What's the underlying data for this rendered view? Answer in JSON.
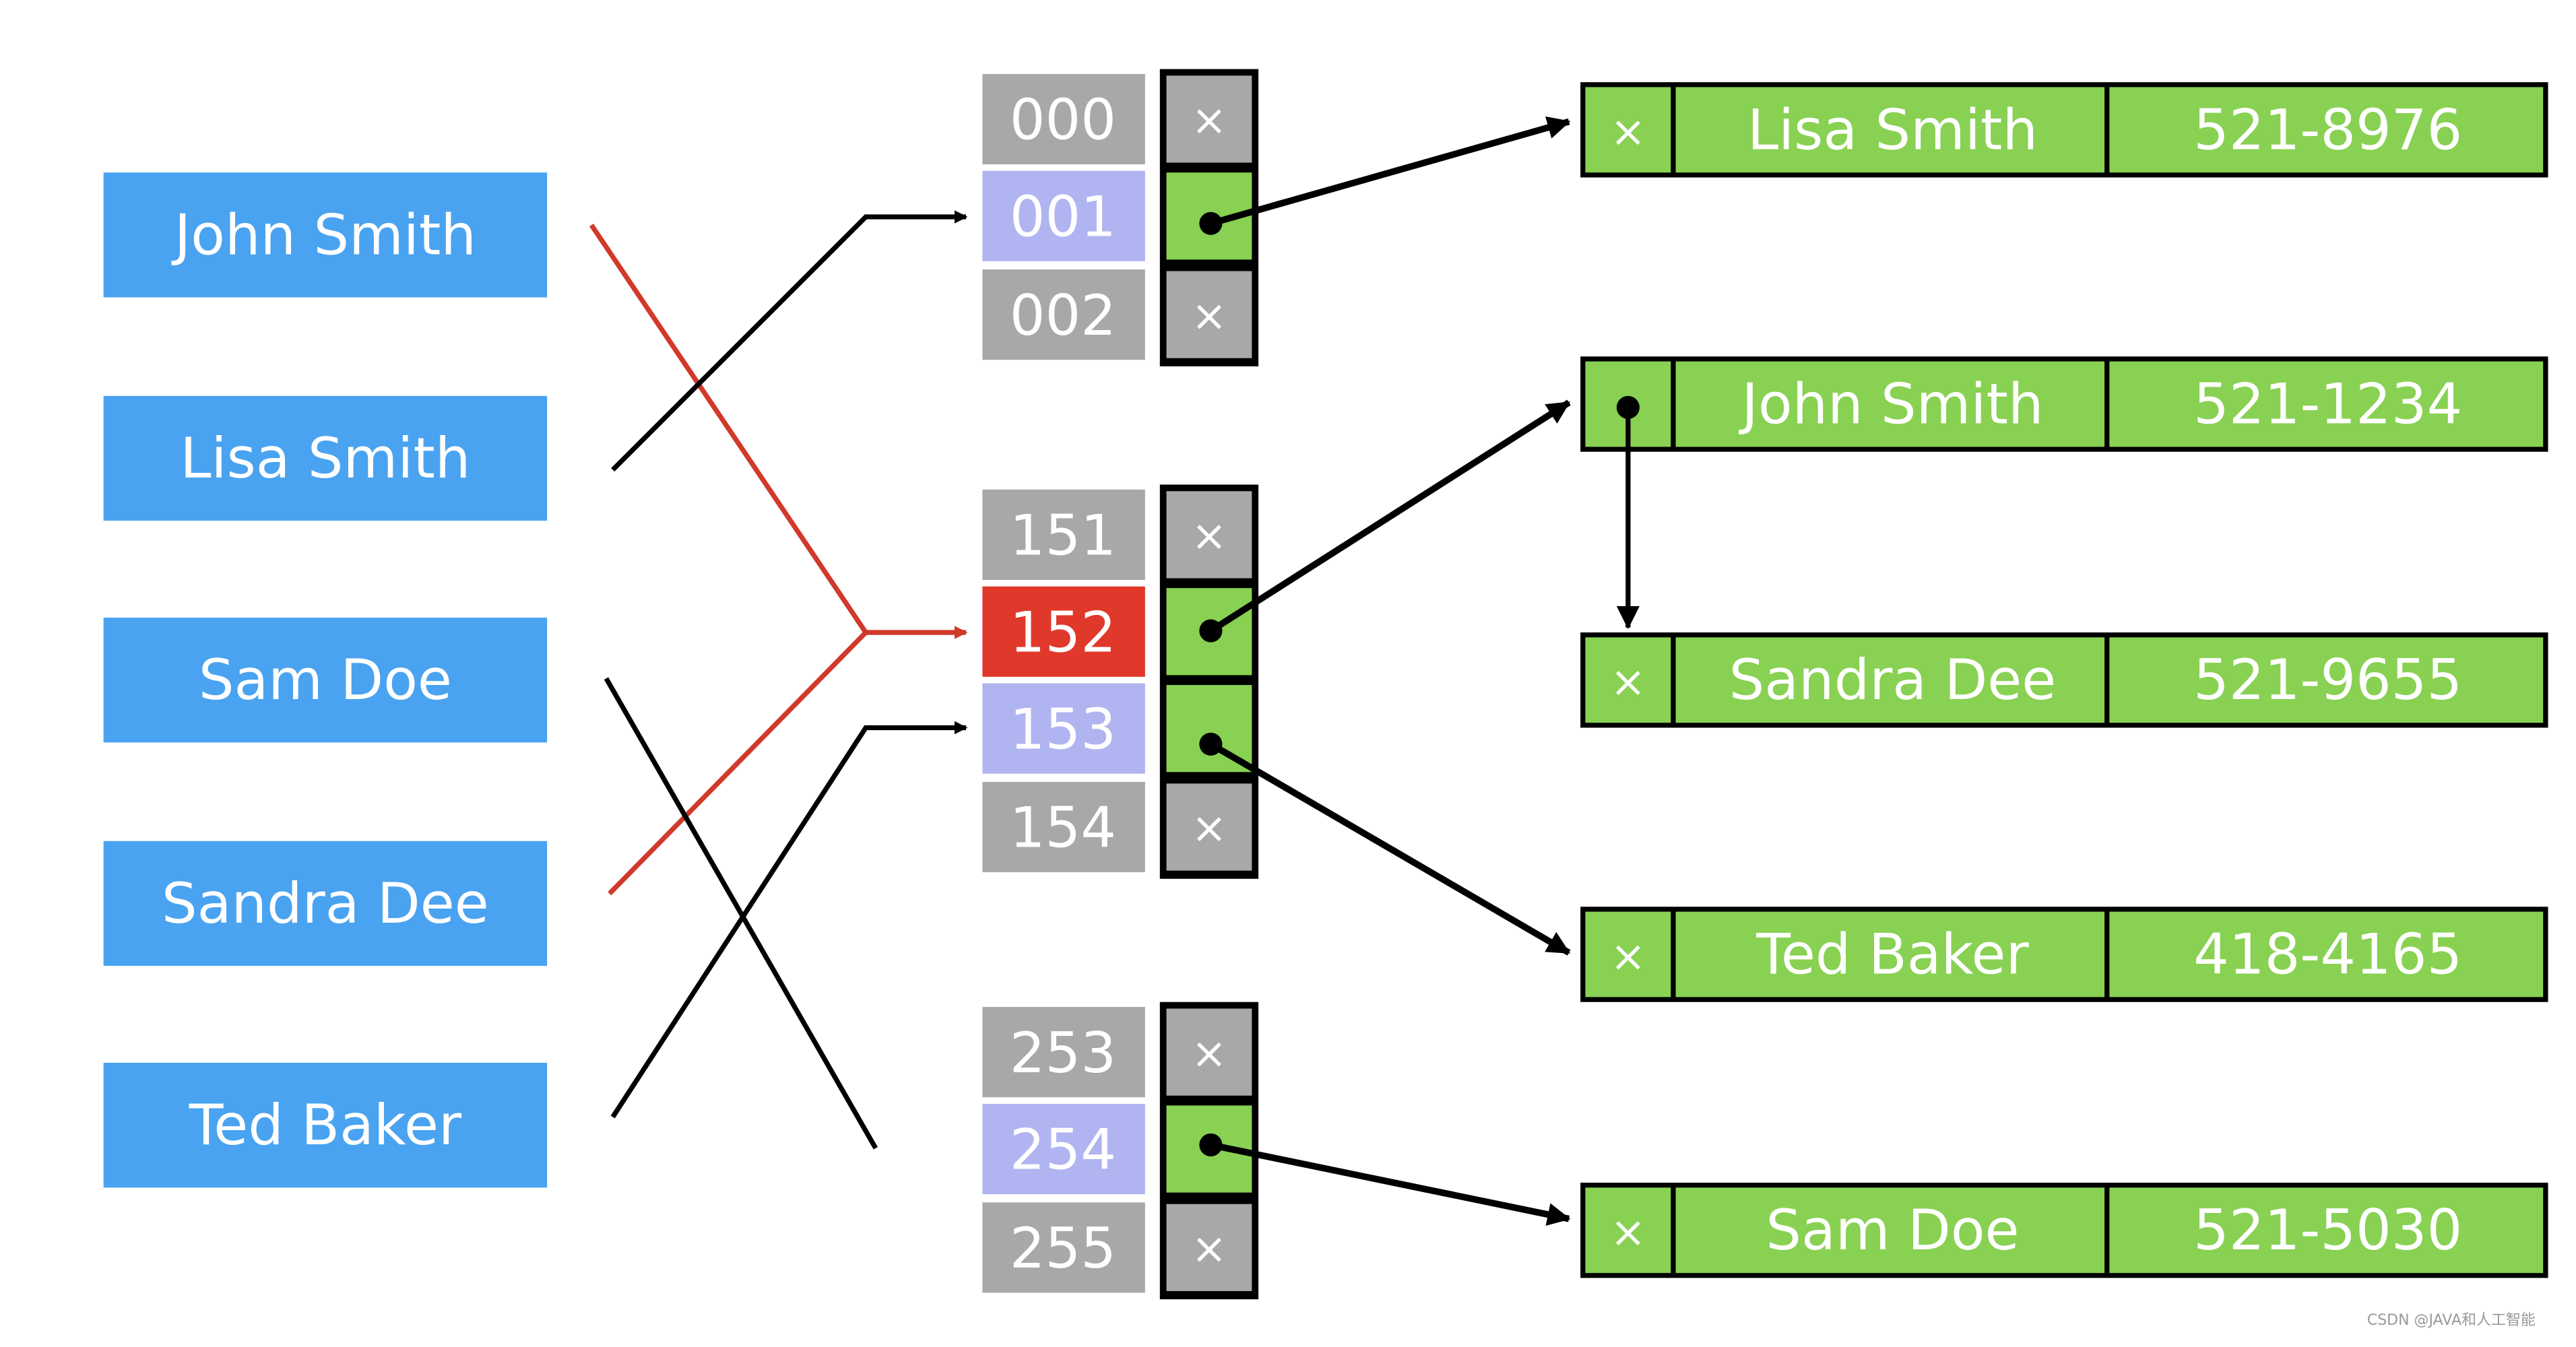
{
  "colors": {
    "key_box": "#4aa3f0",
    "bucket_empty": "#a8a8a8",
    "bucket_used": "#b0b4f0",
    "bucket_collision": "#e0382a",
    "entry": "#88d152",
    "collision_line": "#d0392b",
    "line": "#000000"
  },
  "keys": [
    "John Smith",
    "Lisa Smith",
    "Sam Doe",
    "Sandra Dee",
    "Ted Baker"
  ],
  "buckets": [
    {
      "index": "000",
      "state": "empty",
      "pointer": "×"
    },
    {
      "index": "001",
      "state": "used",
      "pointer": ""
    },
    {
      "index": "002",
      "state": "empty",
      "pointer": "×"
    },
    {
      "index": "151",
      "state": "empty",
      "pointer": "×"
    },
    {
      "index": "152",
      "state": "collision",
      "pointer": ""
    },
    {
      "index": "153",
      "state": "used",
      "pointer": ""
    },
    {
      "index": "154",
      "state": "empty",
      "pointer": "×"
    },
    {
      "index": "253",
      "state": "empty",
      "pointer": "×"
    },
    {
      "index": "254",
      "state": "used",
      "pointer": ""
    },
    {
      "index": "255",
      "state": "empty",
      "pointer": "×"
    }
  ],
  "entries": [
    {
      "next": "×",
      "name": "Lisa Smith",
      "phone": "521-8976"
    },
    {
      "next": "",
      "name": "John Smith",
      "phone": "521-1234"
    },
    {
      "next": "×",
      "name": "Sandra Dee",
      "phone": "521-9655"
    },
    {
      "next": "×",
      "name": "Ted Baker",
      "phone": "418-4165"
    },
    {
      "next": "×",
      "name": "Sam Doe",
      "phone": "521-5030"
    }
  ],
  "watermark": "CSDN @JAVA和人工智能"
}
